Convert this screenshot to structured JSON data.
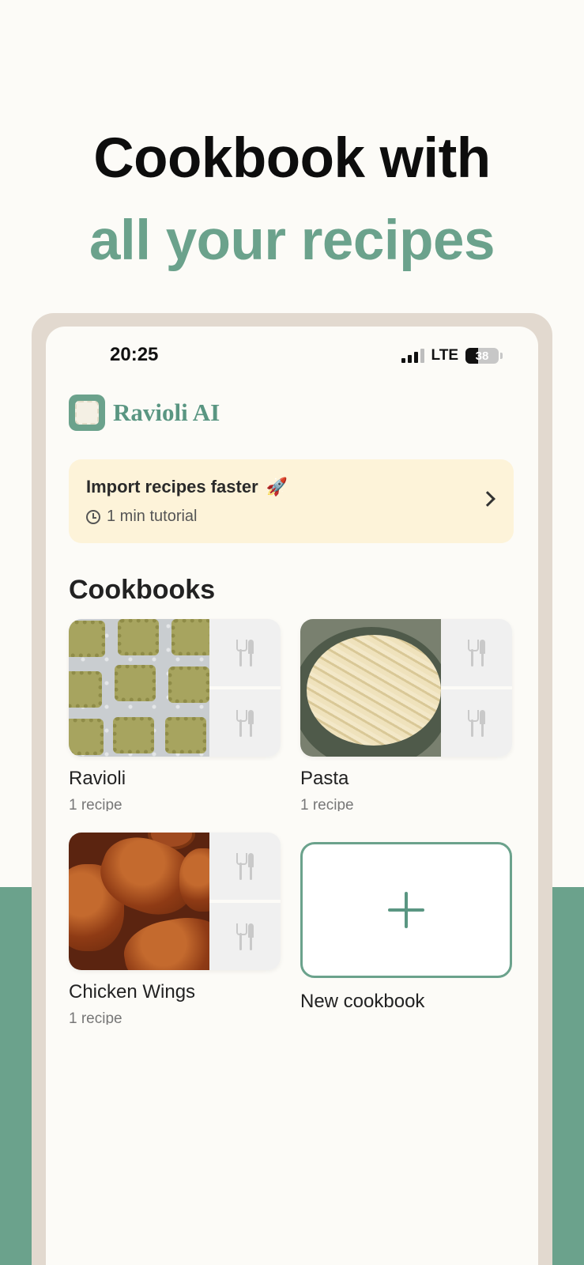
{
  "colors": {
    "accent": "#6ba28c",
    "accent_text": "#5a9682",
    "import_card_bg": "#fdf3d9",
    "frame": "#e2d9cf"
  },
  "headline": {
    "line1": "Cookbook with",
    "line2": "all your recipes"
  },
  "status_bar": {
    "time": "20:25",
    "network": "LTE",
    "battery": "38"
  },
  "brand": {
    "name": "Ravioli AI",
    "icon": "ravioli-logo-icon"
  },
  "import_card": {
    "title": "Import recipes faster",
    "emoji": "🚀",
    "subtitle": "1 min tutorial",
    "icons": [
      "clock-icon",
      "chevron-right-icon"
    ]
  },
  "cookbooks": {
    "title": "Cookbooks",
    "items": [
      {
        "name": "Ravioli",
        "count": "1 recipe"
      },
      {
        "name": "Pasta",
        "count": "1 recipe"
      },
      {
        "name": "Chicken Wings",
        "count": "1 recipe"
      }
    ],
    "new_label": "New cookbook",
    "placeholder_icon": "utensils-icon"
  }
}
